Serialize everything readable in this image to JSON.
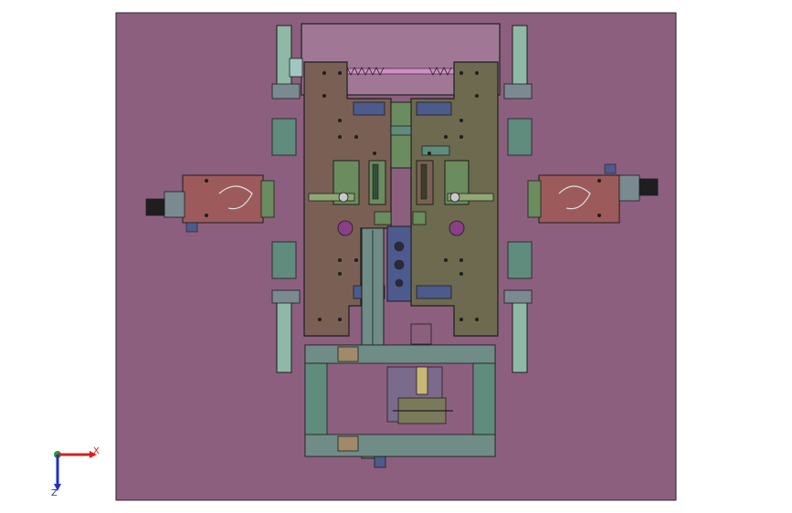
{
  "viewport": {
    "background": "#ffffff",
    "sheet_color": "#8c5f7f",
    "sheet_border": "#2a2a2a"
  },
  "triad": {
    "x_label": "X",
    "z_label": "Z",
    "x_color": "#d42020",
    "y_color": "#20a020",
    "z_color": "#2030c0"
  },
  "palette": {
    "plate": "#7a6054",
    "plate_olive": "#6d6a4f",
    "teal_part": "#5f8c7c",
    "green_part": "#6b8c5e",
    "rail": "#6f8c86",
    "cylinder": "#8fb8a6",
    "red_block": "#9c5a5a",
    "dark_block": "#3d3d4a",
    "blue_block": "#4c5a8c",
    "pink_rod": "#d48cc8",
    "top_block": "#a07896",
    "edge": "#1e1e1e"
  }
}
